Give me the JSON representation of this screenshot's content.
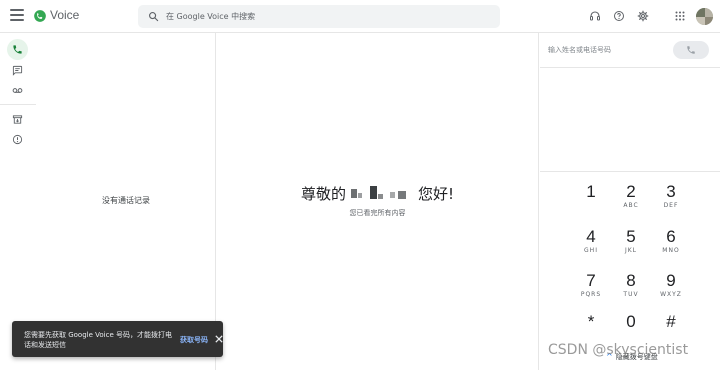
{
  "header": {
    "app_title": "Voice",
    "search_placeholder": "在 Google Voice 中搜索",
    "icons": [
      "menu-icon",
      "voice-logo",
      "search-icon",
      "headset-icon",
      "help-icon",
      "gear-icon",
      "apps-icon",
      "avatar"
    ]
  },
  "nav": {
    "items": [
      {
        "name": "calls",
        "icon": "phone-icon",
        "active": true
      },
      {
        "name": "messages",
        "icon": "message-icon",
        "active": false
      },
      {
        "name": "voicemail",
        "icon": "voicemail-icon",
        "active": false
      },
      {
        "name": "archive",
        "icon": "archive-icon",
        "active": false
      },
      {
        "name": "spam",
        "icon": "spam-icon",
        "active": false
      }
    ]
  },
  "calls_panel": {
    "empty_text": "没有通话记录"
  },
  "main": {
    "greeting_prefix": "尊敬的",
    "greeting_suffix": "您好!",
    "subtitle": "您已看完所有内容"
  },
  "dialer": {
    "input_placeholder": "输入姓名或电话号码",
    "keys": [
      {
        "digit": "1",
        "letters": ""
      },
      {
        "digit": "2",
        "letters": "ABC"
      },
      {
        "digit": "3",
        "letters": "DEF"
      },
      {
        "digit": "4",
        "letters": "GHI"
      },
      {
        "digit": "5",
        "letters": "JKL"
      },
      {
        "digit": "6",
        "letters": "MNO"
      },
      {
        "digit": "7",
        "letters": "PQRS"
      },
      {
        "digit": "8",
        "letters": "TUV"
      },
      {
        "digit": "9",
        "letters": "WXYZ"
      },
      {
        "digit": "*",
        "letters": ""
      },
      {
        "digit": "0",
        "letters": ""
      },
      {
        "digit": "#",
        "letters": ""
      }
    ],
    "hide_label": "隐藏拨号键盘"
  },
  "snackbar": {
    "message": "您需要先获取 Google Voice 号码，才能拨打电话和发送短信",
    "action": "获取号码"
  },
  "watermark": "CSDN @skyscientist",
  "colors": {
    "accent_green": "#188038",
    "active_nav_bg": "#e6f4ea",
    "snackbar_bg": "#323232",
    "snackbar_action": "#8ab4f8"
  }
}
